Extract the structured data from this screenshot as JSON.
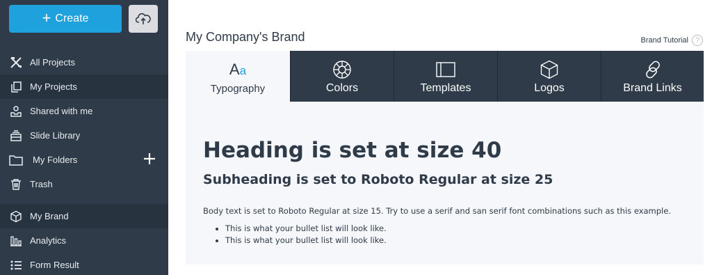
{
  "sidebar": {
    "create_label": "Create",
    "items": [
      {
        "label": "All Projects",
        "icon": "tools-icon"
      },
      {
        "label": "My Projects",
        "icon": "copy-icon"
      },
      {
        "label": "Shared with me",
        "icon": "shared-icon"
      },
      {
        "label": "Slide Library",
        "icon": "library-icon"
      },
      {
        "label": "My Folders",
        "icon": "folder-icon"
      },
      {
        "label": "Trash",
        "icon": "trash-icon"
      },
      {
        "label": "My Brand",
        "icon": "cube-icon"
      },
      {
        "label": "Analytics",
        "icon": "bar-chart-icon"
      },
      {
        "label": "Form Result",
        "icon": "list-icon"
      }
    ]
  },
  "main": {
    "title": "My Company's Brand",
    "tutorial_label": "Brand Tutorial",
    "tutorial_icon_text": "?",
    "tabs": [
      {
        "label": "Typography",
        "icon": "typography-icon",
        "icon_text_a": "A",
        "icon_text_b": "a"
      },
      {
        "label": "Colors",
        "icon": "color-wheel-icon"
      },
      {
        "label": "Templates",
        "icon": "template-icon"
      },
      {
        "label": "Logos",
        "icon": "cube-icon"
      },
      {
        "label": "Brand Links",
        "icon": "link-icon"
      }
    ],
    "heading": "Heading is set at size 40",
    "subheading": "Subheading is set to Roboto Regular at size 25",
    "body": "Body text is set to Roboto Regular at size 15. Try to use a serif and san serif font combinations such as this example.",
    "bullets": [
      "This is what your bullet list will look like.",
      "This is what your bullet list will look like."
    ]
  },
  "colors": {
    "sidebar_bg": "#2f3b48",
    "accent": "#1ea1dc",
    "panel_bg": "#f5f7fa"
  }
}
